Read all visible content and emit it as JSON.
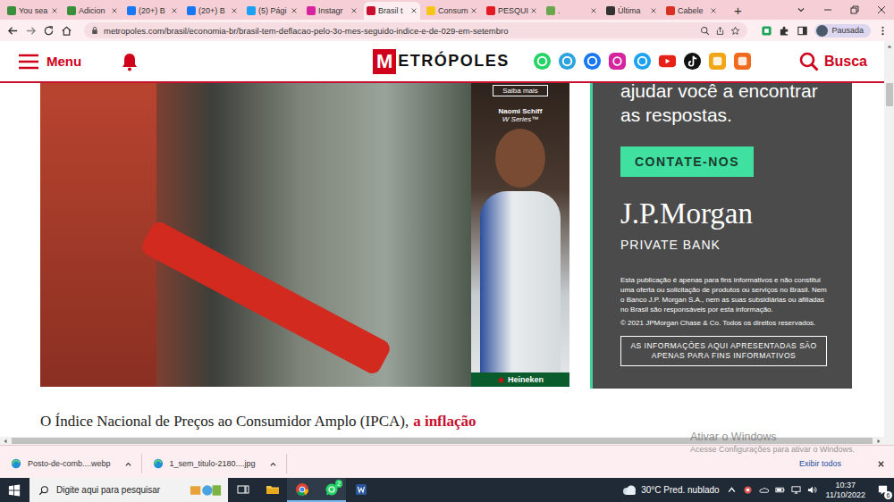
{
  "browser": {
    "tabs": [
      {
        "label": "You sea",
        "selected": false,
        "color": "#3a8f3a"
      },
      {
        "label": "Adicion",
        "selected": false,
        "color": "#3a8f3a"
      },
      {
        "label": "(20+) B",
        "selected": false,
        "color": "#1877f2"
      },
      {
        "label": "(20+) B",
        "selected": false,
        "color": "#1877f2"
      },
      {
        "label": "(5) Pági",
        "selected": false,
        "color": "#1da1f2"
      },
      {
        "label": "Instagr",
        "selected": false,
        "color": "#d6249f"
      },
      {
        "label": "Brasil t",
        "selected": true,
        "color": "#c8102e"
      },
      {
        "label": "Consum",
        "selected": false,
        "color": "#f5c518"
      },
      {
        "label": "PESQUI",
        "selected": false,
        "color": "#e31b23"
      },
      {
        "label": ".",
        "selected": false,
        "color": "#6aa84f"
      },
      {
        "label": "Última",
        "selected": false,
        "color": "#333333"
      },
      {
        "label": "Cabele",
        "selected": false,
        "color": "#d93025"
      }
    ],
    "new_tab": "+",
    "url": "metropoles.com/brasil/economia-br/brasil-tem-deflacao-pelo-3o-mes-seguido-indice-e-de-029-em-setembro",
    "profile": "Pausada"
  },
  "site_header": {
    "menu": "Menu",
    "logo": {
      "mark": "M",
      "rest": "ETRÓPOLES"
    },
    "socials": [
      {
        "kind": "whatsapp",
        "color": "#25d366"
      },
      {
        "kind": "telegram",
        "color": "#2aa3df"
      },
      {
        "kind": "facebook",
        "color": "#1877f2"
      },
      {
        "kind": "instagram",
        "color": "#d6249f"
      },
      {
        "kind": "twitter",
        "color": "#1da1f2"
      },
      {
        "kind": "youtube",
        "color": "#e62117"
      },
      {
        "kind": "tiktok",
        "color": "#111111"
      },
      {
        "kind": "kwai",
        "color": "#f2a516"
      },
      {
        "kind": "flipboard",
        "color": "#f06a1d"
      }
    ],
    "search": "Busca"
  },
  "ads": {
    "heineken": {
      "button": "Saiba mais",
      "athlete": "Naomi Schiff",
      "series": "W Series™",
      "brand": "Heineken"
    },
    "jpmorgan": {
      "headline": [
        "ajudar você a encontrar",
        "as respostas."
      ],
      "cta": "CONTATE-NOS",
      "brand": "J.P.Morgan",
      "division": "PRIVATE BANK",
      "disclaimer": "Esta publicação é apenas para fins informativos e não constitui uma oferta ou solicitação de produtos ou serviços no Brasil. Nem o Banco J.P. Morgan S.A., nem as suas subsidiárias ou afiliadas no Brasil são responsáveis por esta informação.",
      "copyright": "© 2021 JPMorgan Chase & Co. Todos os direitos reservados.",
      "notice": "AS INFORMAÇÕES AQUI APRESENTADAS SÃO APENAS PARA FINS INFORMATIVOS"
    }
  },
  "article": {
    "lead": "O Índice Nacional de Preços ao Consumidor Amplo (IPCA),",
    "link": "a inflação"
  },
  "watermark": {
    "title": "Ativar o Windows",
    "subtitle": "Acesse Configurações para ativar o Windows."
  },
  "downloads": {
    "items": [
      {
        "name": "Posto-de-comb....webp"
      },
      {
        "name": "1_sem_titulo-2180....jpg"
      }
    ],
    "show_all": "Exibir todos"
  },
  "taskbar": {
    "search_placeholder": "Digite aqui para pesquisar",
    "apps": [
      {
        "kind": "task-view",
        "active": false,
        "badge": ""
      },
      {
        "kind": "explorer",
        "active": false,
        "badge": ""
      },
      {
        "kind": "chrome",
        "active": true,
        "badge": ""
      },
      {
        "kind": "whatsapp",
        "active": true,
        "badge": "2"
      },
      {
        "kind": "word",
        "active": false,
        "badge": ""
      }
    ],
    "weather": "30°C Pred. nublado",
    "time": "10:37",
    "date": "11/10/2022",
    "notifications": "6"
  }
}
